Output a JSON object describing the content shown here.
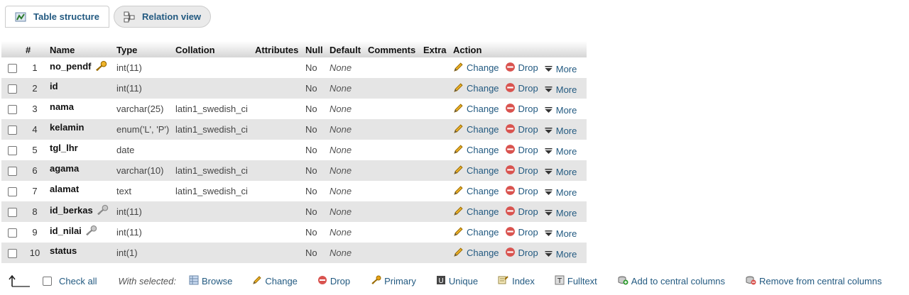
{
  "tabs": [
    {
      "label": "Table structure",
      "icon": "table-structure-icon"
    },
    {
      "label": "Relation view",
      "icon": "relation-view-icon"
    }
  ],
  "table": {
    "headers": [
      "#",
      "Name",
      "Type",
      "Collation",
      "Attributes",
      "Null",
      "Default",
      "Comments",
      "Extra",
      "Action"
    ],
    "rows": [
      {
        "num": "1",
        "name": "no_pendf",
        "key": "primary",
        "type": "int(11)",
        "collation": "",
        "null": "No",
        "default": "None"
      },
      {
        "num": "2",
        "name": "id",
        "key": "",
        "type": "int(11)",
        "collation": "",
        "null": "No",
        "default": "None"
      },
      {
        "num": "3",
        "name": "nama",
        "key": "",
        "type": "varchar(25)",
        "collation": "latin1_swedish_ci",
        "null": "No",
        "default": "None"
      },
      {
        "num": "4",
        "name": "kelamin",
        "key": "",
        "type": "enum('L', 'P')",
        "collation": "latin1_swedish_ci",
        "null": "No",
        "default": "None"
      },
      {
        "num": "5",
        "name": "tgl_lhr",
        "key": "",
        "type": "date",
        "collation": "",
        "null": "No",
        "default": "None"
      },
      {
        "num": "6",
        "name": "agama",
        "key": "",
        "type": "varchar(10)",
        "collation": "latin1_swedish_ci",
        "null": "No",
        "default": "None"
      },
      {
        "num": "7",
        "name": "alamat",
        "key": "",
        "type": "text",
        "collation": "latin1_swedish_ci",
        "null": "No",
        "default": "None"
      },
      {
        "num": "8",
        "name": "id_berkas",
        "key": "index",
        "type": "int(11)",
        "collation": "",
        "null": "No",
        "default": "None"
      },
      {
        "num": "9",
        "name": "id_nilai",
        "key": "index",
        "type": "int(11)",
        "collation": "",
        "null": "No",
        "default": "None"
      },
      {
        "num": "10",
        "name": "status",
        "key": "",
        "type": "int(1)",
        "collation": "",
        "null": "No",
        "default": "None"
      }
    ],
    "actions": {
      "change": "Change",
      "drop": "Drop",
      "more": "More"
    }
  },
  "bottom": {
    "check_all": "Check all",
    "with_selected": "With selected:",
    "browse": "Browse",
    "change": "Change",
    "drop": "Drop",
    "primary": "Primary",
    "unique": "Unique",
    "index": "Index",
    "fulltext": "Fulltext",
    "add_central": "Add to central columns",
    "remove_central": "Remove from central columns"
  },
  "colors": {
    "link": "#235a81",
    "row_even": "#e5e5e5",
    "drop_red": "#d9534f",
    "pencil": "#e8a317"
  }
}
